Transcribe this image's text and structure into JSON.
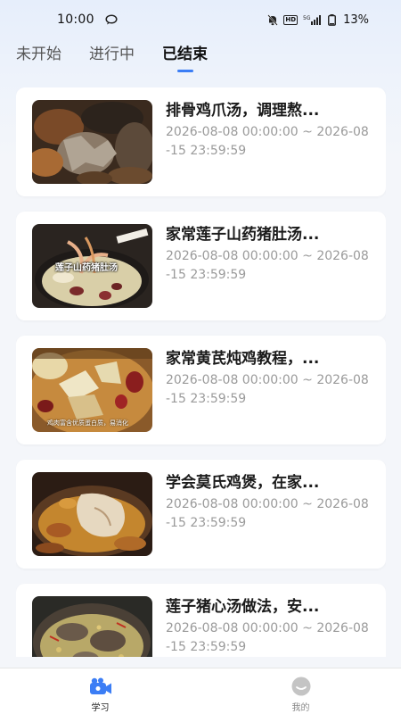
{
  "status_bar": {
    "time": "10:00",
    "network": "5G",
    "battery": "13%"
  },
  "tabs": [
    {
      "label": "未开始"
    },
    {
      "label": "进行中"
    },
    {
      "label": "已结束"
    }
  ],
  "active_tab": "已结束",
  "courses": [
    {
      "title": "排骨鸡爪汤，调理熬...",
      "time": "2026-08-08 00:00:00 ~ 2026-08-15 23:59:59"
    },
    {
      "title": "家常莲子山药猪肚汤...",
      "time": "2026-08-08 00:00:00 ~ 2026-08-15 23:59:59",
      "image_caption": "莲子山药猪肚汤"
    },
    {
      "title": "家常黄芪炖鸡教程，...",
      "time": "2026-08-08 00:00:00 ~ 2026-08-15 23:59:59",
      "image_caption": "鸡肉富含优质蛋白质，易消化"
    },
    {
      "title": "学会莫氏鸡煲，在家...",
      "time": "2026-08-08 00:00:00 ~ 2026-08-15 23:59:59"
    },
    {
      "title": "莲子猪心汤做法，安...",
      "time": "2026-08-08 00:00:00 ~ 2026-08-15 23:59:59"
    }
  ],
  "bottom_nav": [
    {
      "label": "学习",
      "icon": "camera-icon",
      "active": true
    },
    {
      "label": "我的",
      "icon": "profile-icon",
      "active": false
    }
  ],
  "colors": {
    "accent": "#3b7df5",
    "inactive": "#c4c4c4"
  }
}
